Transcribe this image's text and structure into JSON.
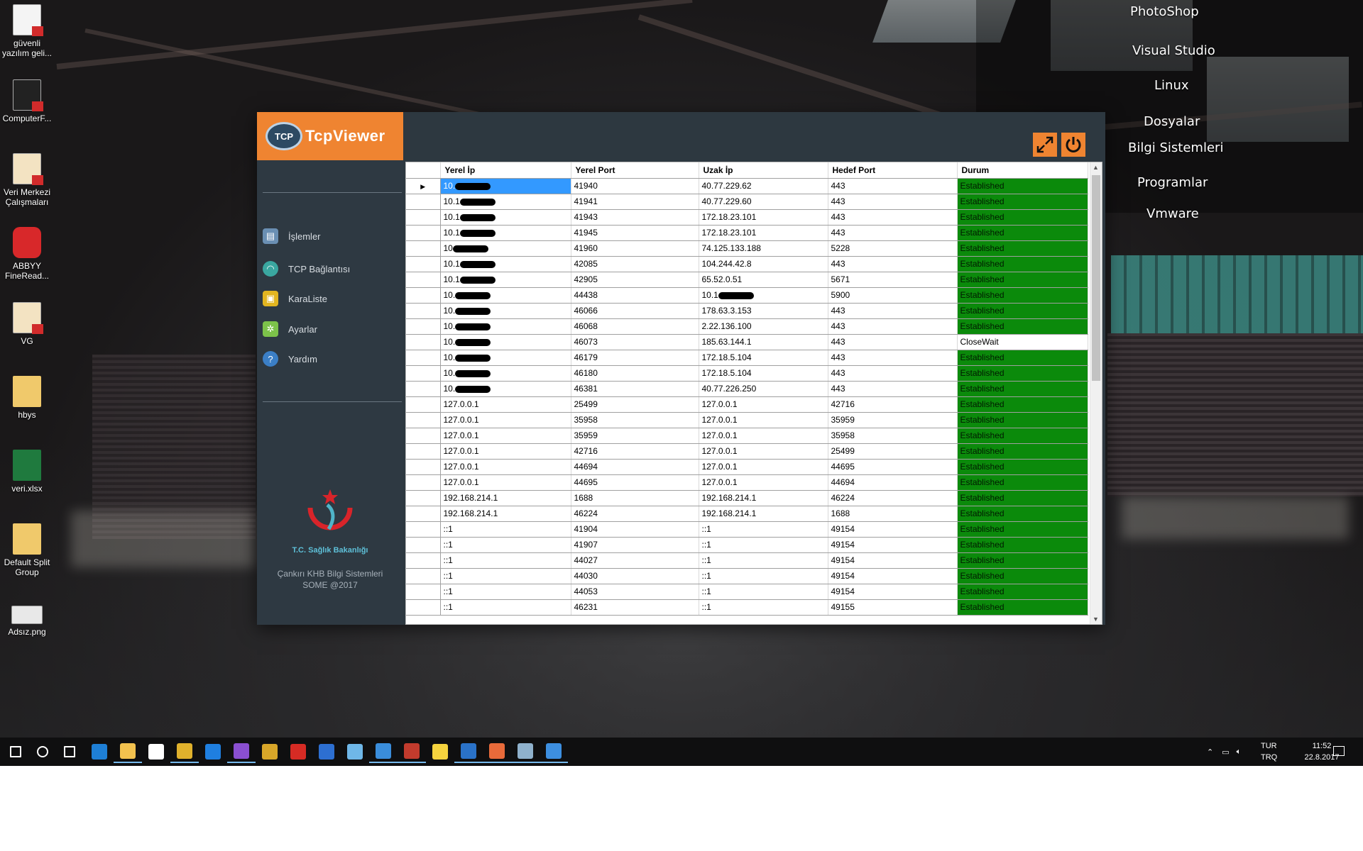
{
  "desktop": {
    "icons": [
      {
        "label": "güvenli\nyazılım geli...",
        "type": "pdf-icon"
      },
      {
        "label": "ComputerF...",
        "type": "pdf-icon"
      },
      {
        "label": "Veri Merkezi\nÇalışmaları",
        "type": "pdf-icon"
      },
      {
        "label": "ABBYY\nFineRead...",
        "type": "app-icon"
      },
      {
        "label": "VG",
        "type": "pdf-icon"
      },
      {
        "label": "hbys",
        "type": "folder-icon"
      },
      {
        "label": "veri.xlsx",
        "type": "excel-icon"
      },
      {
        "label": "Default Split\nGroup",
        "type": "folder-icon"
      },
      {
        "label": "Adsız.png",
        "type": "image-icon"
      }
    ],
    "right_menu": [
      "PhotoShop",
      "Visual Studio",
      "Linux",
      "Dosyalar",
      "Bilgi Sistemleri",
      "Programlar",
      "Vmware"
    ]
  },
  "app": {
    "logo_badge": "TCP",
    "title": "TcpViewer",
    "nav": [
      {
        "label": "İşlemler",
        "icon": "process-icon",
        "color": "#6a8fb3"
      },
      {
        "label": "TCP Bağlantısı",
        "icon": "wifi-icon",
        "color": "#3aa7a0"
      },
      {
        "label": "KaraListe",
        "icon": "lock-icon",
        "color": "#e2b520"
      },
      {
        "label": "Ayarlar",
        "icon": "gear-icon",
        "color": "#7cc24a"
      },
      {
        "label": "Yardım",
        "icon": "help-icon",
        "color": "#3b7fc6"
      }
    ],
    "ministry_name": "T.C. Sağlık Bakanlığı",
    "footer_line1": "Çankırı KHB Bilgi Sistemleri",
    "footer_line2": "SOME @2017",
    "accent_color": "#ef8431"
  },
  "grid": {
    "columns": [
      "Yerel İp",
      "Yerel Port",
      "Uzak İp",
      "Hedef Port",
      "Durum"
    ],
    "rows": [
      {
        "local_ip": "10.",
        "local_port": "41940",
        "remote_ip": "40.77.229.62",
        "remote_port": "443",
        "status": "Established",
        "masked_local": true,
        "selected": true
      },
      {
        "local_ip": "10.1",
        "local_port": "41941",
        "remote_ip": "40.77.229.60",
        "remote_port": "443",
        "status": "Established",
        "masked_local": true
      },
      {
        "local_ip": "10.1",
        "local_port": "41943",
        "remote_ip": "172.18.23.101",
        "remote_port": "443",
        "status": "Established",
        "masked_local": true
      },
      {
        "local_ip": "10.1",
        "local_port": "41945",
        "remote_ip": "172.18.23.101",
        "remote_port": "443",
        "status": "Established",
        "masked_local": true
      },
      {
        "local_ip": "10",
        "local_port": "41960",
        "remote_ip": "74.125.133.188",
        "remote_port": "5228",
        "status": "Established",
        "masked_local": true
      },
      {
        "local_ip": "10.1",
        "local_port": "42085",
        "remote_ip": "104.244.42.8",
        "remote_port": "443",
        "status": "Established",
        "masked_local": true
      },
      {
        "local_ip": "10.1",
        "local_port": "42905",
        "remote_ip": "65.52.0.51",
        "remote_port": "5671",
        "status": "Established",
        "masked_local": true
      },
      {
        "local_ip": "10.",
        "local_port": "44438",
        "remote_ip": "10.1",
        "remote_port": "5900",
        "status": "Established",
        "masked_local": true,
        "masked_remote": true
      },
      {
        "local_ip": "10.",
        "local_port": "46066",
        "remote_ip": "178.63.3.153",
        "remote_port": "443",
        "status": "Established",
        "masked_local": true
      },
      {
        "local_ip": "10.",
        "local_port": "46068",
        "remote_ip": "2.22.136.100",
        "remote_port": "443",
        "status": "Established",
        "masked_local": true
      },
      {
        "local_ip": "10.",
        "local_port": "46073",
        "remote_ip": "185.63.144.1",
        "remote_port": "443",
        "status": "CloseWait",
        "masked_local": true
      },
      {
        "local_ip": "10.",
        "local_port": "46179",
        "remote_ip": "172.18.5.104",
        "remote_port": "443",
        "status": "Established",
        "masked_local": true
      },
      {
        "local_ip": "10.",
        "local_port": "46180",
        "remote_ip": "172.18.5.104",
        "remote_port": "443",
        "status": "Established",
        "masked_local": true
      },
      {
        "local_ip": "10.",
        "local_port": "46381",
        "remote_ip": "40.77.226.250",
        "remote_port": "443",
        "status": "Established",
        "masked_local": true
      },
      {
        "local_ip": "127.0.0.1",
        "local_port": "25499",
        "remote_ip": "127.0.0.1",
        "remote_port": "42716",
        "status": "Established"
      },
      {
        "local_ip": "127.0.0.1",
        "local_port": "35958",
        "remote_ip": "127.0.0.1",
        "remote_port": "35959",
        "status": "Established"
      },
      {
        "local_ip": "127.0.0.1",
        "local_port": "35959",
        "remote_ip": "127.0.0.1",
        "remote_port": "35958",
        "status": "Established"
      },
      {
        "local_ip": "127.0.0.1",
        "local_port": "42716",
        "remote_ip": "127.0.0.1",
        "remote_port": "25499",
        "status": "Established"
      },
      {
        "local_ip": "127.0.0.1",
        "local_port": "44694",
        "remote_ip": "127.0.0.1",
        "remote_port": "44695",
        "status": "Established"
      },
      {
        "local_ip": "127.0.0.1",
        "local_port": "44695",
        "remote_ip": "127.0.0.1",
        "remote_port": "44694",
        "status": "Established"
      },
      {
        "local_ip": "192.168.214.1",
        "local_port": "1688",
        "remote_ip": "192.168.214.1",
        "remote_port": "46224",
        "status": "Established"
      },
      {
        "local_ip": "192.168.214.1",
        "local_port": "46224",
        "remote_ip": "192.168.214.1",
        "remote_port": "1688",
        "status": "Established"
      },
      {
        "local_ip": "::1",
        "local_port": "41904",
        "remote_ip": "::1",
        "remote_port": "49154",
        "status": "Established"
      },
      {
        "local_ip": "::1",
        "local_port": "41907",
        "remote_ip": "::1",
        "remote_port": "49154",
        "status": "Established"
      },
      {
        "local_ip": "::1",
        "local_port": "44027",
        "remote_ip": "::1",
        "remote_port": "49154",
        "status": "Established"
      },
      {
        "local_ip": "::1",
        "local_port": "44030",
        "remote_ip": "::1",
        "remote_port": "49154",
        "status": "Established"
      },
      {
        "local_ip": "::1",
        "local_port": "44053",
        "remote_ip": "::1",
        "remote_port": "49154",
        "status": "Established"
      },
      {
        "local_ip": "::1",
        "local_port": "46231",
        "remote_ip": "::1",
        "remote_port": "49155",
        "status": "Established"
      }
    ],
    "status_colors": {
      "Established": "#0b8a0b",
      "CloseWait": "#ffffff"
    }
  },
  "taskbar": {
    "items": [
      {
        "name": "start-icon",
        "color": "#ffffff"
      },
      {
        "name": "search-icon",
        "color": "#ffffff"
      },
      {
        "name": "task-view-icon",
        "color": "#ffffff"
      },
      {
        "name": "edge-icon",
        "color": "#1e7fd6"
      },
      {
        "name": "file-explorer-icon",
        "color": "#f2c14e",
        "active": true
      },
      {
        "name": "store-icon",
        "color": "#ffffff"
      },
      {
        "name": "chrome-icon",
        "color": "#e0b12c",
        "active": true
      },
      {
        "name": "teamviewer-icon",
        "color": "#1f7fe0"
      },
      {
        "name": "visual-studio-icon",
        "color": "#8a4fd1",
        "active": true
      },
      {
        "name": "app-yellow-icon",
        "color": "#d8a629"
      },
      {
        "name": "filezilla-icon",
        "color": "#d62b24"
      },
      {
        "name": "app-blue-icon",
        "color": "#2d6fd1"
      },
      {
        "name": "network-app-icon",
        "color": "#6fb7e8"
      },
      {
        "name": "vs-code-icon",
        "color": "#3a8ddb",
        "active": true
      },
      {
        "name": "filezilla-2-icon",
        "color": "#c23b2d",
        "active": true
      },
      {
        "name": "sticky-notes-icon",
        "color": "#f5d33e"
      },
      {
        "name": "outlook-icon",
        "color": "#2a72c8",
        "active": true
      },
      {
        "name": "tcpviewer-icon",
        "color": "#e86a3a",
        "active": true
      },
      {
        "name": "app-drawing-icon",
        "color": "#8fb1cc",
        "active": true
      },
      {
        "name": "app-window-icon",
        "color": "#3d8fe0",
        "active": true
      }
    ],
    "lang_top": "TUR",
    "lang_bottom": "TRQ",
    "time": "11:52",
    "date": "22.8.2017"
  }
}
